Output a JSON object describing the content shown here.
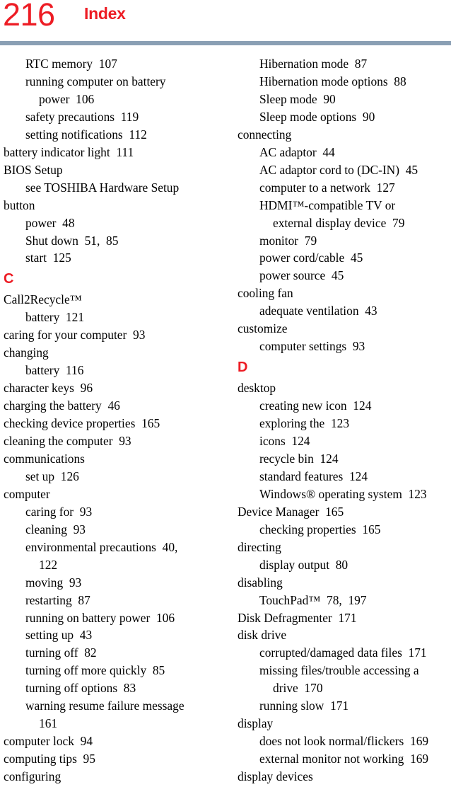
{
  "page": {
    "folio": "216",
    "title": "Index",
    "rule_color": "#8a9fb4",
    "accent_color": "#ed1c24",
    "text_color": "#000000",
    "background_color": "#ffffff"
  },
  "columns": [
    {
      "name": "left-column",
      "entries": [
        {
          "level": 1,
          "text": "RTC memory  107"
        },
        {
          "level": 1,
          "text": "running computer on battery"
        },
        {
          "level": 2,
          "text": "power  106"
        },
        {
          "level": 1,
          "text": "safety precautions  119"
        },
        {
          "level": 1,
          "text": "setting notifications  112"
        },
        {
          "level": 0,
          "text": "battery indicator light  111"
        },
        {
          "level": 0,
          "text": "BIOS Setup"
        },
        {
          "level": 1,
          "text": "see TOSHIBA Hardware Setup"
        },
        {
          "level": 0,
          "text": "button"
        },
        {
          "level": 1,
          "text": "power  48"
        },
        {
          "level": 1,
          "text": "Shut down  51,  85"
        },
        {
          "level": 1,
          "text": "start  125"
        },
        {
          "letter": "C"
        },
        {
          "level": 0,
          "text": "Call2Recycle™"
        },
        {
          "level": 1,
          "text": "battery  121"
        },
        {
          "level": 0,
          "text": "caring for your computer  93"
        },
        {
          "level": 0,
          "text": "changing"
        },
        {
          "level": 1,
          "text": "battery  116"
        },
        {
          "level": 0,
          "text": "character keys  96"
        },
        {
          "level": 0,
          "text": "charging the battery  46"
        },
        {
          "level": 0,
          "text": "checking device properties  165"
        },
        {
          "level": 0,
          "text": "cleaning the computer  93"
        },
        {
          "level": 0,
          "text": "communications"
        },
        {
          "level": 1,
          "text": "set up  126"
        },
        {
          "level": 0,
          "text": "computer"
        },
        {
          "level": 1,
          "text": "caring for  93"
        },
        {
          "level": 1,
          "text": "cleaning  93"
        },
        {
          "level": 1,
          "text": "environmental precautions  40,"
        },
        {
          "level": 2,
          "text": "122"
        },
        {
          "level": 1,
          "text": "moving  93"
        },
        {
          "level": 1,
          "text": "restarting  87"
        },
        {
          "level": 1,
          "text": "running on battery power  106"
        },
        {
          "level": 1,
          "text": "setting up  43"
        },
        {
          "level": 1,
          "text": "turning off  82"
        },
        {
          "level": 1,
          "text": "turning off more quickly  85"
        },
        {
          "level": 1,
          "text": "turning off options  83"
        },
        {
          "level": 1,
          "text": "warning resume failure message"
        },
        {
          "level": 2,
          "text": "161"
        },
        {
          "level": 0,
          "text": "computer lock  94"
        },
        {
          "level": 0,
          "text": "computing tips  95"
        },
        {
          "level": 0,
          "text": "configuring"
        }
      ]
    },
    {
      "name": "right-column",
      "entries": [
        {
          "level": 1,
          "text": "Hibernation mode  87"
        },
        {
          "level": 1,
          "text": "Hibernation mode options  88"
        },
        {
          "level": 1,
          "text": "Sleep mode  90"
        },
        {
          "level": 1,
          "text": "Sleep mode options  90"
        },
        {
          "level": 0,
          "text": "connecting"
        },
        {
          "level": 1,
          "text": "AC adaptor  44"
        },
        {
          "level": 1,
          "text": "AC adaptor cord to (DC-IN)  45"
        },
        {
          "level": 1,
          "text": "computer to a network  127"
        },
        {
          "level": 1,
          "text": "HDMI™-compatible TV or"
        },
        {
          "level": 2,
          "text": "external display device  79"
        },
        {
          "level": 1,
          "text": "monitor  79"
        },
        {
          "level": 1,
          "text": "power cord/cable  45"
        },
        {
          "level": 1,
          "text": "power source  45"
        },
        {
          "level": 0,
          "text": "cooling fan"
        },
        {
          "level": 1,
          "text": "adequate ventilation  43"
        },
        {
          "level": 0,
          "text": "customize"
        },
        {
          "level": 1,
          "text": "computer settings  93"
        },
        {
          "letter": "D"
        },
        {
          "level": 0,
          "text": "desktop"
        },
        {
          "level": 1,
          "text": "creating new icon  124"
        },
        {
          "level": 1,
          "text": "exploring the  123"
        },
        {
          "level": 1,
          "text": "icons  124"
        },
        {
          "level": 1,
          "text": "recycle bin  124"
        },
        {
          "level": 1,
          "text": "standard features  124"
        },
        {
          "level": 1,
          "text": "Windows® operating system  123"
        },
        {
          "level": 0,
          "text": "Device Manager  165"
        },
        {
          "level": 1,
          "text": "checking properties  165"
        },
        {
          "level": 0,
          "text": "directing"
        },
        {
          "level": 1,
          "text": "display output  80"
        },
        {
          "level": 0,
          "text": "disabling"
        },
        {
          "level": 1,
          "text": "TouchPad™  78,  197"
        },
        {
          "level": 0,
          "text": "Disk Defragmenter  171"
        },
        {
          "level": 0,
          "text": "disk drive"
        },
        {
          "level": 1,
          "text": "corrupted/damaged data files  171"
        },
        {
          "level": 1,
          "text": "missing files/trouble accessing a"
        },
        {
          "level": 2,
          "text": "drive  170"
        },
        {
          "level": 1,
          "text": "running slow  171"
        },
        {
          "level": 0,
          "text": "display"
        },
        {
          "level": 1,
          "text": "does not look normal/flickers  169"
        },
        {
          "level": 1,
          "text": "external monitor not working  169"
        },
        {
          "level": 0,
          "text": "display devices"
        }
      ]
    }
  ]
}
